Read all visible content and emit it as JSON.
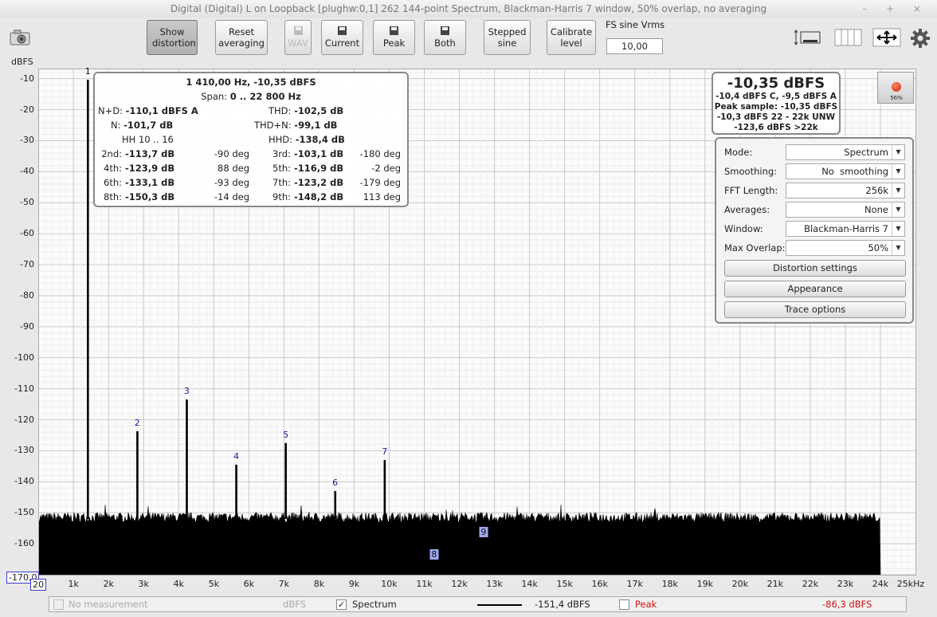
{
  "window": {
    "title": "Digital (Digital) L on Loopback [plughw:0,1] 262 144-point Spectrum, Blackman-Harris 7 window, 50% overlap, no averaging",
    "controls": "– + ×"
  },
  "toolbar": {
    "show_distortion": "Show distortion",
    "reset_averaging": "Reset averaging",
    "wav": "WAV",
    "current": "Current",
    "peak": "Peak",
    "both": "Both",
    "stepped_sine": "Stepped sine",
    "calibrate_level": "Calibrate level",
    "fs_label": "FS sine Vrms",
    "fs_value": "10,00"
  },
  "plot": {
    "y_unit": "dBFS",
    "y_min_label": "-170,0",
    "x_min_label": "20",
    "y_ticks": [
      "-10",
      "-20",
      "-30",
      "-40",
      "-50",
      "-60",
      "-70",
      "-80",
      "-90",
      "-100",
      "-110",
      "-120",
      "-130",
      "-140",
      "-150",
      "-160"
    ],
    "x_ticks": [
      "1k",
      "2k",
      "3k",
      "4k",
      "5k",
      "6k",
      "7k",
      "8k",
      "9k",
      "10k",
      "11k",
      "12k",
      "13k",
      "14k",
      "15k",
      "16k",
      "17k",
      "18k",
      "19k",
      "20k",
      "21k",
      "22k",
      "23k",
      "24k",
      "25kHz"
    ]
  },
  "chart_data": {
    "type": "line",
    "xlabel": "",
    "ylabel": "dBFS",
    "xlim": [
      20,
      25000
    ],
    "ylim": [
      -170,
      -7
    ],
    "noise_floor_dbfs": -152,
    "noise_end_hz": 24000,
    "harmonics": [
      {
        "label": "1",
        "freq": 1410,
        "level": -10.35
      },
      {
        "label": "2",
        "freq": 2820,
        "level": -123.7
      },
      {
        "label": "3",
        "freq": 4230,
        "level": -113.5
      },
      {
        "label": "4",
        "freq": 5640,
        "level": -134.5
      },
      {
        "label": "5",
        "freq": 7050,
        "level": -127.5
      },
      {
        "label": "6",
        "freq": 8460,
        "level": -143.0
      },
      {
        "label": "7",
        "freq": 9870,
        "level": -133.0
      }
    ],
    "subfloor_labels": [
      {
        "label": "9",
        "freq": 12690,
        "level": -156.5
      },
      {
        "label": "8",
        "freq": 11280,
        "level": -163.5
      }
    ]
  },
  "distortion": {
    "header": "1 410,00 Hz, -10,35 dBFS",
    "span_label": "Span:",
    "span_value": "0 .. 22 800 Hz",
    "nd_label": "N+D:",
    "nd_value": "-110,1 dBFS A",
    "thd_label": "THD:",
    "thd_value": "-102,5 dB",
    "n_label": "N:",
    "n_value": "-101,7 dB",
    "thdn_label": "THD+N:",
    "thdn_value": "-99,1 dB",
    "hh_label": "HH 10 .. 16",
    "hhd_label": "HHD:",
    "hhd_value": "-138,4 dB",
    "rows": [
      {
        "l1": "2nd:",
        "v1": "-113,7 dB",
        "p1": "-90 deg",
        "l2": "3rd:",
        "v2": "-103,1 dB",
        "p2": "-180 deg"
      },
      {
        "l1": "4th:",
        "v1": "-123,9 dB",
        "p1": "88 deg",
        "l2": "5th:",
        "v2": "-116,9 dB",
        "p2": "-2 deg"
      },
      {
        "l1": "6th:",
        "v1": "-133,1 dB",
        "p1": "-93 deg",
        "l2": "7th:",
        "v2": "-123,2 dB",
        "p2": "-179 deg"
      },
      {
        "l1": "8th:",
        "v1": "-150,3 dB",
        "p1": "-14 deg",
        "l2": "9th:",
        "v2": "-148,2 dB",
        "p2": "113 deg"
      }
    ]
  },
  "readout": {
    "main": "-10,35 dBFS",
    "line1": "-10,4 dBFS C, -9,5 dBFS A",
    "line2": "Peak sample: -10,35 dBFS",
    "line3": "-10,3 dBFS 22 - 22k UNW",
    "line4": "-123,6 dBFS >22k",
    "led_pct": "56%"
  },
  "settings": {
    "mode_label": "Mode:",
    "mode_value": "Spectrum",
    "smoothing_label": "Smoothing:",
    "smoothing_value": "No  smoothing",
    "fft_label": "FFT Length:",
    "fft_value": "256k",
    "avg_label": "Averages:",
    "avg_value": "None",
    "window_label": "Window:",
    "window_value": "Blackman-Harris 7",
    "overlap_label": "Max Overlap:",
    "overlap_value": "50%",
    "distortion_settings": "Distortion settings",
    "appearance": "Appearance",
    "trace_options": "Trace options"
  },
  "legend": {
    "no_measurement": "No measurement",
    "unit": "dBFS",
    "spectrum": "Spectrum",
    "spectrum_value": "-151,4 dBFS",
    "peak": "Peak",
    "peak_value": "-86,3 dBFS",
    "peak_color": "#c81010"
  }
}
